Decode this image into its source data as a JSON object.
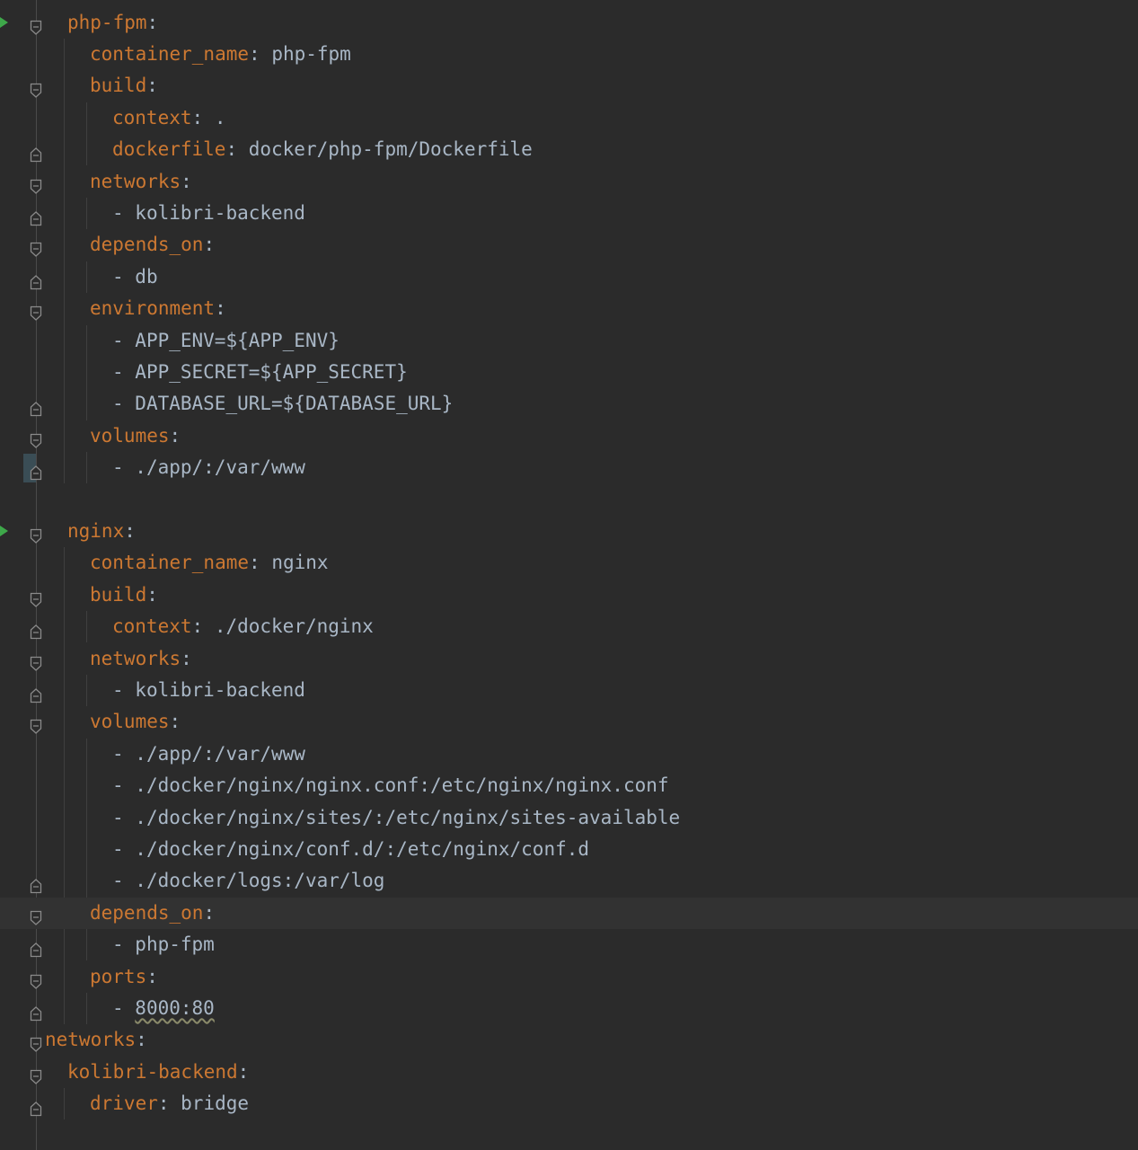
{
  "lines": [
    {
      "key": "php-fpm",
      "sep": ":",
      "val": "",
      "indent": 1,
      "fold": "open",
      "run": true
    },
    {
      "key": "container_name",
      "sep": ": ",
      "val": "php-fpm",
      "indent": 2,
      "fold": ""
    },
    {
      "key": "build",
      "sep": ":",
      "val": "",
      "indent": 2,
      "fold": "open"
    },
    {
      "key": "context",
      "sep": ": ",
      "val": ".",
      "indent": 3,
      "fold": ""
    },
    {
      "key": "dockerfile",
      "sep": ": ",
      "val": "docker/php-fpm/Dockerfile",
      "indent": 3,
      "fold": "close"
    },
    {
      "key": "networks",
      "sep": ":",
      "val": "",
      "indent": 2,
      "fold": "open"
    },
    {
      "key": "",
      "sep": "- ",
      "val": "kolibri-backend",
      "indent": 3,
      "fold": "close"
    },
    {
      "key": "depends_on",
      "sep": ":",
      "val": "",
      "indent": 2,
      "fold": "open"
    },
    {
      "key": "",
      "sep": "- ",
      "val": "db",
      "indent": 3,
      "fold": "close"
    },
    {
      "key": "environment",
      "sep": ":",
      "val": "",
      "indent": 2,
      "fold": "open"
    },
    {
      "key": "",
      "sep": "- ",
      "val": "APP_ENV=${APP_ENV}",
      "indent": 3,
      "fold": ""
    },
    {
      "key": "",
      "sep": "- ",
      "val": "APP_SECRET=${APP_SECRET}",
      "indent": 3,
      "fold": ""
    },
    {
      "key": "",
      "sep": "- ",
      "val": "DATABASE_URL=${DATABASE_URL}",
      "indent": 3,
      "fold": "close"
    },
    {
      "key": "volumes",
      "sep": ":",
      "val": "",
      "indent": 2,
      "fold": "open"
    },
    {
      "key": "",
      "sep": "- ",
      "val": "./app/:/var/www",
      "indent": 3,
      "fold": "close",
      "bookmark": true
    },
    {
      "key": "",
      "sep": "",
      "val": "",
      "indent": 0,
      "fold": ""
    },
    {
      "key": "nginx",
      "sep": ":",
      "val": "",
      "indent": 1,
      "fold": "open",
      "run": true
    },
    {
      "key": "container_name",
      "sep": ": ",
      "val": "nginx",
      "indent": 2,
      "fold": ""
    },
    {
      "key": "build",
      "sep": ":",
      "val": "",
      "indent": 2,
      "fold": "open"
    },
    {
      "key": "context",
      "sep": ": ",
      "val": "./docker/nginx",
      "indent": 3,
      "fold": "close"
    },
    {
      "key": "networks",
      "sep": ":",
      "val": "",
      "indent": 2,
      "fold": "open"
    },
    {
      "key": "",
      "sep": "- ",
      "val": "kolibri-backend",
      "indent": 3,
      "fold": "close"
    },
    {
      "key": "volumes",
      "sep": ":",
      "val": "",
      "indent": 2,
      "fold": "open"
    },
    {
      "key": "",
      "sep": "- ",
      "val": "./app/:/var/www",
      "indent": 3,
      "fold": ""
    },
    {
      "key": "",
      "sep": "- ",
      "val": "./docker/nginx/nginx.conf:/etc/nginx/nginx.conf",
      "indent": 3,
      "fold": ""
    },
    {
      "key": "",
      "sep": "- ",
      "val": "./docker/nginx/sites/:/etc/nginx/sites-available",
      "indent": 3,
      "fold": ""
    },
    {
      "key": "",
      "sep": "- ",
      "val": "./docker/nginx/conf.d/:/etc/nginx/conf.d",
      "indent": 3,
      "fold": ""
    },
    {
      "key": "",
      "sep": "- ",
      "val": "./docker/logs:/var/log",
      "indent": 3,
      "fold": "close"
    },
    {
      "key": "depends_on",
      "sep": ":",
      "val": "",
      "indent": 2,
      "fold": "open",
      "current": true
    },
    {
      "key": "",
      "sep": "- ",
      "val": "php-fpm",
      "indent": 3,
      "fold": "close"
    },
    {
      "key": "ports",
      "sep": ":",
      "val": "",
      "indent": 2,
      "fold": "open"
    },
    {
      "key": "",
      "sep": "- ",
      "val": "8000:80",
      "indent": 3,
      "fold": "close",
      "warn": true
    },
    {
      "key": "networks",
      "sep": ":",
      "val": "",
      "indent": 0,
      "fold": "open"
    },
    {
      "key": "kolibri-backend",
      "sep": ":",
      "val": "",
      "indent": 1,
      "fold": "open"
    },
    {
      "key": "driver",
      "sep": ": ",
      "val": "bridge",
      "indent": 2,
      "fold": "close"
    }
  ],
  "colors": {
    "background": "#2b2b2b",
    "key": "#cc7832",
    "text": "#a9b7c6",
    "run_marker": "#3ea84a",
    "current_line": "#323232"
  },
  "icons": {
    "run": "run-gutter-icon",
    "fold_open": "fold-open-icon",
    "fold_close": "fold-close-icon"
  }
}
